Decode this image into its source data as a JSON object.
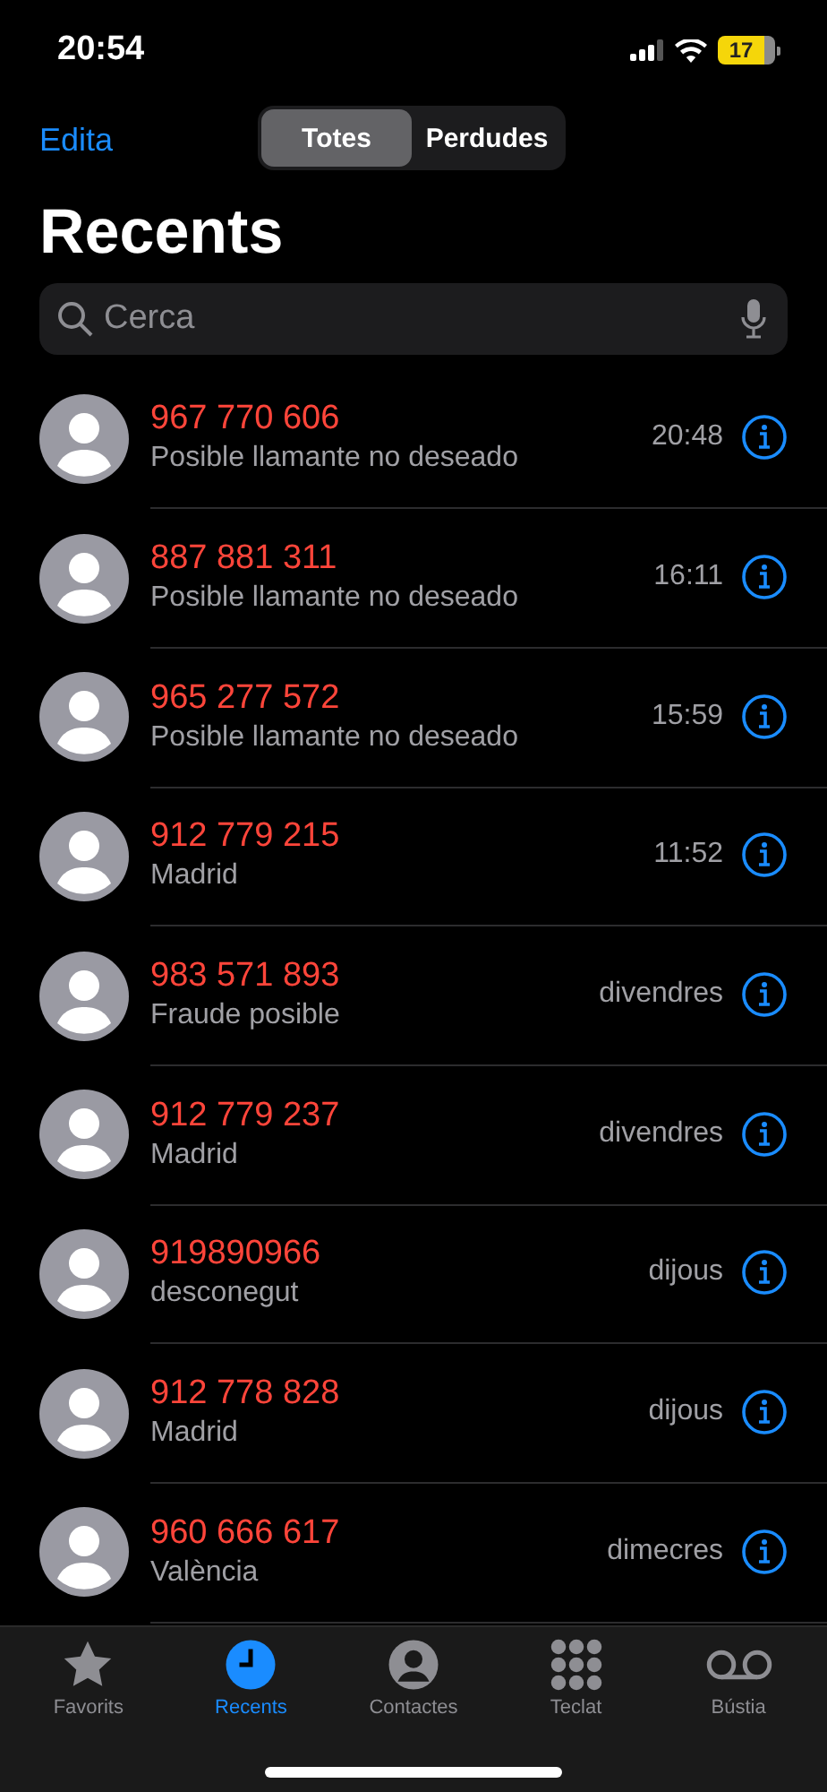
{
  "status_bar": {
    "time": "20:54",
    "battery_text": "17"
  },
  "nav": {
    "edit": "Edita",
    "segments": [
      {
        "label": "Totes",
        "selected": true
      },
      {
        "label": "Perdudes",
        "selected": false
      }
    ]
  },
  "title": "Recents",
  "search": {
    "placeholder": "Cerca"
  },
  "calls": [
    {
      "number": "967 770 606",
      "detail": "Posible llamante no deseado",
      "when": "20:48",
      "missed": true
    },
    {
      "number": "887 881 311",
      "detail": "Posible llamante no deseado",
      "when": "16:11",
      "missed": true
    },
    {
      "number": "965 277 572",
      "detail": "Posible llamante no deseado",
      "when": "15:59",
      "missed": true
    },
    {
      "number": "912 779 215",
      "detail": "Madrid",
      "when": "11:52",
      "missed": true
    },
    {
      "number": "983 571 893",
      "detail": "Fraude posible",
      "when": "divendres",
      "missed": true
    },
    {
      "number": "912 779 237",
      "detail": "Madrid",
      "when": "divendres",
      "missed": true
    },
    {
      "number": "919890966",
      "detail": "desconegut",
      "when": "dijous",
      "missed": true
    },
    {
      "number": "912 778 828",
      "detail": "Madrid",
      "when": "dijous",
      "missed": true
    },
    {
      "number": "960 666 617",
      "detail": "València",
      "when": "dimecres",
      "missed": true
    }
  ],
  "tab_bar": [
    {
      "kind": "star",
      "label": "Favorits",
      "selected": false
    },
    {
      "kind": "clock",
      "label": "Recents",
      "selected": true
    },
    {
      "kind": "person",
      "label": "Contactes",
      "selected": false
    },
    {
      "kind": "keypad",
      "label": "Teclat",
      "selected": false
    },
    {
      "kind": "voicemail",
      "label": "Bústia",
      "selected": false
    }
  ]
}
